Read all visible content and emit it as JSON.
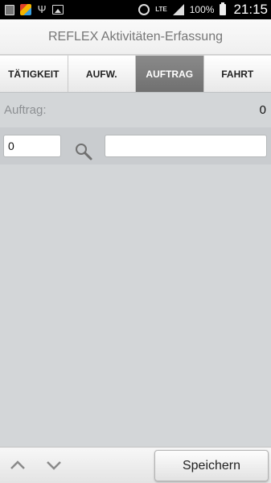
{
  "status_bar": {
    "lte": "LTE",
    "battery": "100%",
    "time": "21:15"
  },
  "app": {
    "title": "REFLEX Aktivitäten-Erfassung"
  },
  "tabs": [
    {
      "label": "TÄTIGKEIT",
      "active": false
    },
    {
      "label": "AUFW.",
      "active": false
    },
    {
      "label": "AUFTRAG",
      "active": true
    },
    {
      "label": "FAHRT",
      "active": false
    }
  ],
  "info": {
    "label": "Auftrag:",
    "value": "0"
  },
  "search": {
    "number_value": "0",
    "text_value": "",
    "icon": "search-icon"
  },
  "footer": {
    "up_icon": "chevron-up-icon",
    "down_icon": "chevron-down-icon",
    "save_label": "Speichern"
  },
  "colors": {
    "active_tab": "#7c7c7c",
    "background": "#d3d6d8"
  }
}
